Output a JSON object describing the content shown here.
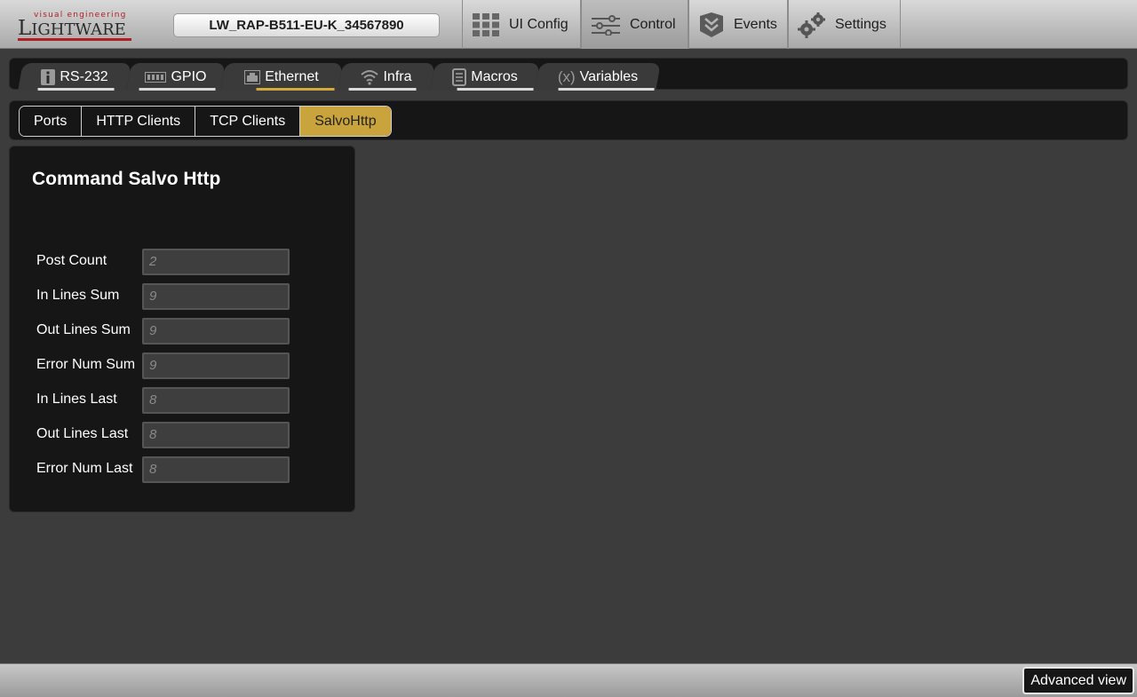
{
  "brand": {
    "tagline": "visual engineering",
    "name_big": "L",
    "name_rest": "IGHTWARE"
  },
  "device": {
    "name": "LW_RAP-B511-EU-K_34567890"
  },
  "nav": [
    {
      "label": "UI Config",
      "icon": "grid-icon"
    },
    {
      "label": "Control",
      "icon": "sliders-icon",
      "active": true
    },
    {
      "label": "Events",
      "icon": "events-icon"
    },
    {
      "label": "Settings",
      "icon": "gears-icon"
    }
  ],
  "tabs": [
    {
      "label": "RS-232",
      "icon": "info-icon"
    },
    {
      "label": "GPIO",
      "icon": "gpio-icon"
    },
    {
      "label": "Ethernet",
      "icon": "ethernet-icon",
      "active": true
    },
    {
      "label": "Infra",
      "icon": "wireless-icon"
    },
    {
      "label": "Macros",
      "icon": "macro-icon"
    },
    {
      "label": "Variables",
      "icon": "variable-icon"
    }
  ],
  "subtabs": [
    {
      "label": "Ports"
    },
    {
      "label": "HTTP Clients"
    },
    {
      "label": "TCP Clients"
    },
    {
      "label": "SalvoHttp",
      "active": true
    }
  ],
  "panel": {
    "title": "Command Salvo Http",
    "fields": [
      {
        "label": "Post Count",
        "value": "2"
      },
      {
        "label": "In Lines Sum",
        "value": "9"
      },
      {
        "label": "Out Lines Sum",
        "value": "9"
      },
      {
        "label": "Error Num Sum",
        "value": "9"
      },
      {
        "label": "In Lines Last",
        "value": "8"
      },
      {
        "label": "Out Lines Last",
        "value": "8"
      },
      {
        "label": "Error Num Last",
        "value": "8"
      }
    ]
  },
  "footer": {
    "advanced_label": "Advanced view"
  },
  "colors": {
    "accent": "#c9a33b",
    "brand_red": "#b01f24",
    "panel_bg": "#161616",
    "page_bg": "#3c3c3c"
  }
}
